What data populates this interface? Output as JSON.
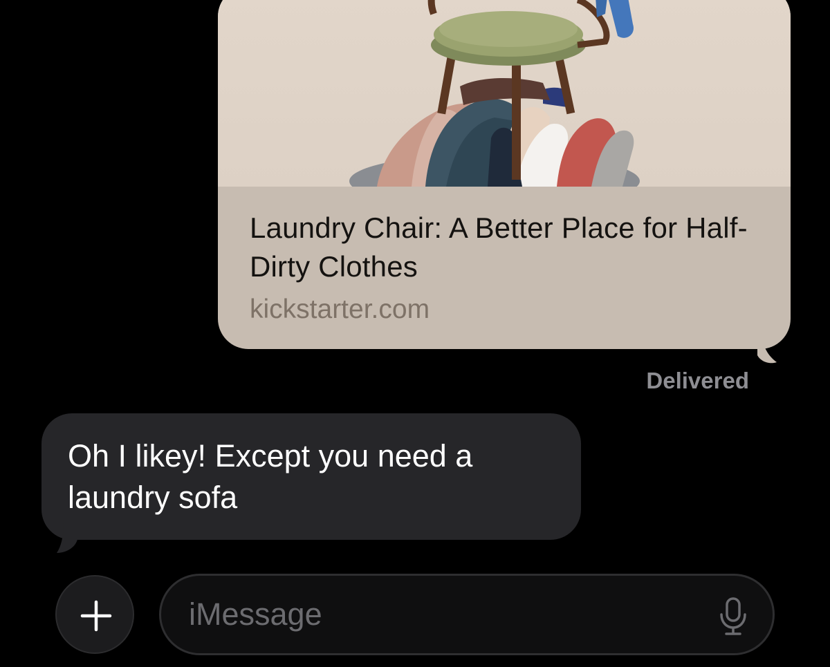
{
  "link_preview": {
    "title": "Laundry Chair: A Better Place for Half-Dirty Clothes",
    "domain": "kickstarter.com",
    "image_icon": "laundry-chair-photo"
  },
  "status": {
    "delivered": "Delivered"
  },
  "incoming": {
    "text": "Oh I likey! Except you need a laundry sofa"
  },
  "composer": {
    "placeholder": "iMessage",
    "plus_icon": "plus-icon",
    "mic_icon": "microphone-icon"
  },
  "colors": {
    "background": "#000000",
    "link_card": "#c7bcb1",
    "incoming_bubble": "#262629",
    "domain_text": "#7e7267",
    "status_text": "#8e8e93"
  }
}
